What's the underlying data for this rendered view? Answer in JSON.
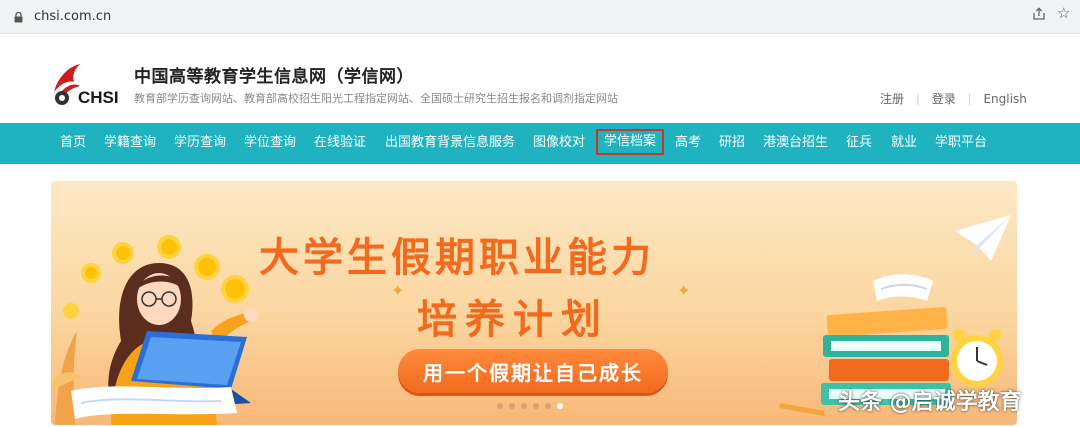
{
  "browser": {
    "url": "chsi.com.cn",
    "icons": [
      "lock-icon",
      "share-icon",
      "star-icon"
    ]
  },
  "header": {
    "logo_text": "CHSI",
    "title": "中国高等教育学生信息网（学信网）",
    "subtitle": "教育部学历查询网站、教育部高校招生阳光工程指定网站、全国硕士研究生招生报名和调剂指定网站",
    "links": {
      "register": "注册",
      "login": "登录",
      "english": "English",
      "separator": "|"
    }
  },
  "nav": {
    "items": [
      "首页",
      "学籍查询",
      "学历查询",
      "学位查询",
      "在线验证",
      "出国教育背景信息服务",
      "图像校对",
      "学信档案",
      "高考",
      "研招",
      "港澳台招生",
      "征兵",
      "就业",
      "学职平台"
    ],
    "active_index": 7,
    "color": "#1fb3bf",
    "highlight_color": "#c0392b"
  },
  "banner": {
    "headline": "大学生假期职业能力",
    "subline": "培养计划",
    "button": "用一个假期让自己成长",
    "slide_count": 6,
    "active_slide": 5,
    "text_color": "#f26a1d"
  },
  "watermark": "头条 @启诚学教育"
}
